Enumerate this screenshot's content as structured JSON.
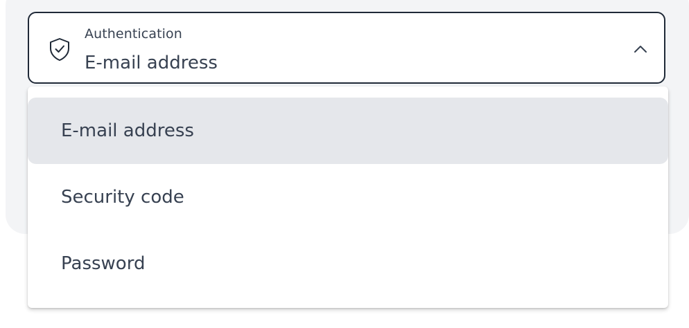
{
  "select": {
    "label": "Authentication",
    "value": "E-mail address",
    "icon": "shield-check-icon",
    "expanded_indicator": "chevron-up-icon"
  },
  "options": [
    {
      "label": "E-mail address",
      "selected": true
    },
    {
      "label": "Security code",
      "selected": false
    },
    {
      "label": "Password",
      "selected": false
    }
  ],
  "colors": {
    "border": "#1f2937",
    "text": "#374151",
    "selected_bg": "#e5e7eb",
    "page_bg": "#f3f4f6"
  }
}
